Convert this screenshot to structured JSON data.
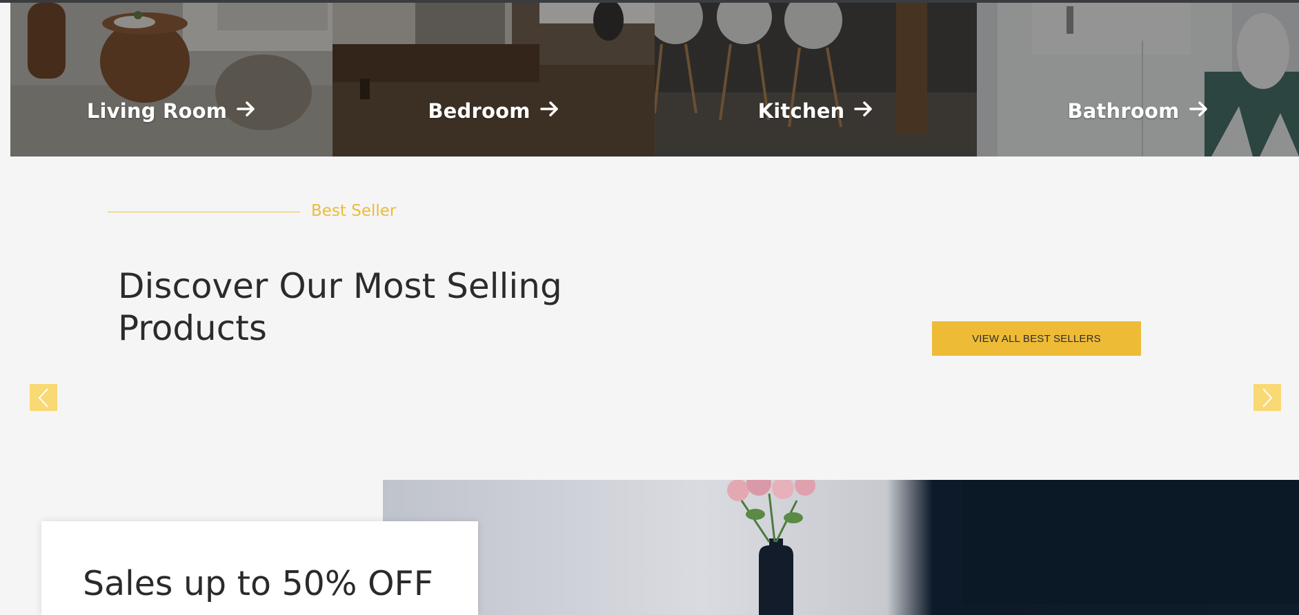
{
  "categories": [
    {
      "label": "Living Room",
      "icon": "arrow-right-icon"
    },
    {
      "label": "Bedroom",
      "icon": "arrow-right-icon"
    },
    {
      "label": "Kitchen",
      "icon": "arrow-right-icon"
    },
    {
      "label": "Bathroom",
      "icon": "arrow-right-icon"
    }
  ],
  "best_seller": {
    "eyebrow": "Best Seller",
    "heading": "Discover Our Most Selling Products",
    "cta_label": "VIEW ALL BEST SELLERS"
  },
  "carousel": {
    "prev_icon": "chevron-left-icon",
    "next_icon": "chevron-right-icon"
  },
  "promo": {
    "title": "Sales up to 50% OFF"
  },
  "colors": {
    "accent": "#edbb36",
    "nav_button": "#f8d973",
    "text_dark": "#2b2b2b",
    "background": "#f5f5f5"
  }
}
